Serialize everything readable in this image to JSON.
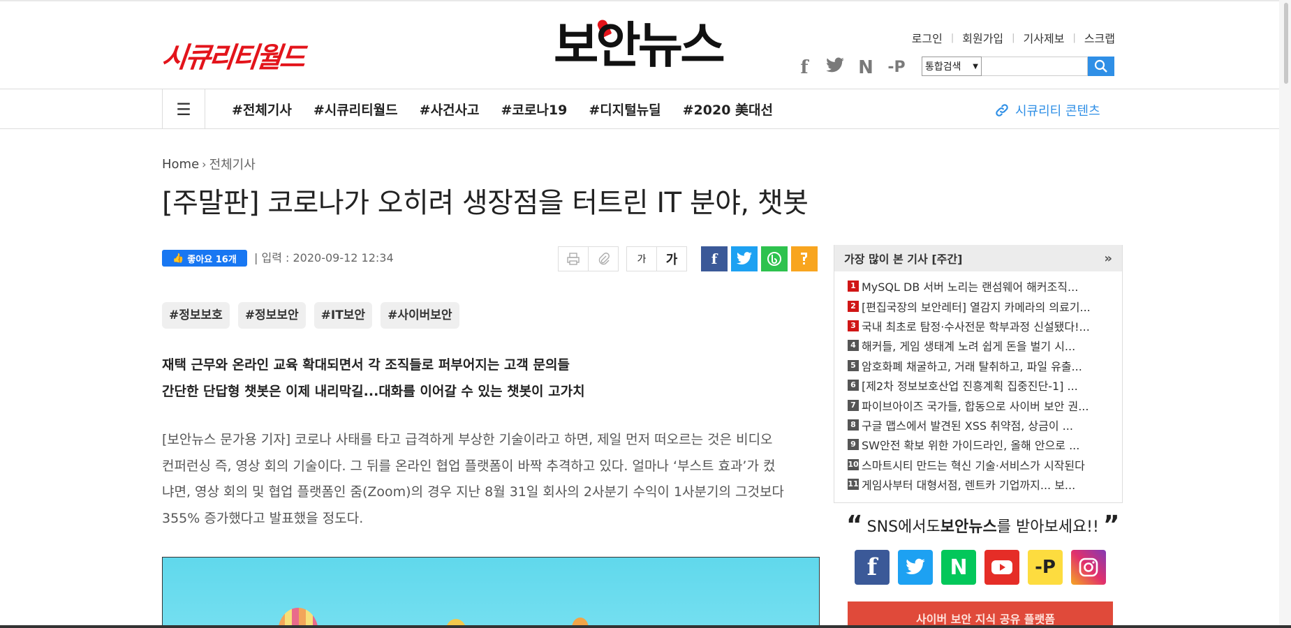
{
  "header": {
    "securityworld_logo": "시큐리티월드",
    "boannews_logo": "보안뉴스",
    "top_links": [
      "로그인",
      "회원가입",
      "기사제보",
      "스크랩"
    ],
    "sns": [
      {
        "icon": "facebook-icon",
        "glyph": "f"
      },
      {
        "icon": "twitter-icon",
        "glyph": "🐦"
      },
      {
        "icon": "naver-icon",
        "glyph": "N"
      },
      {
        "icon": "post-icon",
        "glyph": "-P"
      }
    ],
    "search": {
      "select_value": "통합검색",
      "placeholder": ""
    }
  },
  "nav": {
    "items": [
      "#전체기사",
      "#시큐리티월드",
      "#사건사고",
      "#코로나19",
      "#디지털뉴딜",
      "#2020 美대선"
    ],
    "right_link": "시큐리티 콘텐츠"
  },
  "article": {
    "breadcrumb": {
      "home": "Home",
      "current": "전체기사"
    },
    "title": "[주말판] 코로나가 오히려 생장점을 터트린 IT 분야, 챗봇",
    "like_label": "좋아요 16개",
    "input_date": "| 입력 : 2020-09-12 12:34",
    "font_small": "가",
    "font_large": "가",
    "tags": [
      "#정보보호",
      "#정보보안",
      "#IT보안",
      "#사이버보안"
    ],
    "subheads": [
      "재택 근무와 온라인 교육 확대되면서 각 조직들로 퍼부어지는 고객 문의들",
      "간단한 단답형 챗봇은 이제 내리막길...대화를 이어갈 수 있는 챗봇이 고가치"
    ],
    "body_lines": [
      "[보안뉴스 문가용 기자] 코로나 사태를 타고 급격하게 부상한 기술이라고 하면, 제일 먼저 떠오르는 것은 비디오",
      "컨퍼런싱 즉, 영상 회의 기술이다. 그 뒤를 온라인 협업 플랫폼이 바짝 추격하고 있다. 얼마나 ‘부스트 효과’가 컸",
      "냐면, 영상 회의 및 협업 플랫폼인 줌(Zoom)의 경우 지난 8월 31일 회사의 2사분기 수익이 1사분기의 그것보다",
      "355% 증가했다고 발표했을 정도다."
    ]
  },
  "sidebar": {
    "popular_title": "가장 많이 본 기사 [주간]",
    "popular_more": "»",
    "popular_items": [
      {
        "rank": "1",
        "text": "MySQL DB 서버 노리는 랜섬웨어 해커조직..."
      },
      {
        "rank": "2",
        "text": "[편집국장의 보안레터] 열감지 카메라의 의료기..."
      },
      {
        "rank": "3",
        "text": "국내 최초로 탐정·수사전문 학부과정 신설됐다!..."
      },
      {
        "rank": "4",
        "text": "해커들, 게임 생태계 노려 쉽게 돈을 벌기 시..."
      },
      {
        "rank": "5",
        "text": "암호화폐 채굴하고, 거래 탈취하고, 파일 유출..."
      },
      {
        "rank": "6",
        "text": "[제2차 정보보호산업 진흥계획 집중진단-1] ..."
      },
      {
        "rank": "7",
        "text": "파이브아이즈 국가들, 합동으로 사이버 보안 권..."
      },
      {
        "rank": "8",
        "text": "구글 맵스에서 발견된 XSS 취약점, 상금이 ..."
      },
      {
        "rank": "9",
        "text": "SW안전 확보 위한 가이드라인, 올해 안으로 ..."
      },
      {
        "rank": "10",
        "text": "스마트시티 만드는 혁신 기술·서비스가 시작된다"
      },
      {
        "rank": "11",
        "text": "게임사부터 대형서점, 렌트카 기업까지... 보..."
      }
    ],
    "sns_title_pre": "SNS에서도 ",
    "sns_title_bold": "보안뉴스",
    "sns_title_post": "를 받아보세요!!",
    "sns_icons": [
      {
        "name": "facebook",
        "glyph": "f",
        "color": "#3b5998"
      },
      {
        "name": "twitter",
        "glyph": "🐦",
        "color": "#1da1f2"
      },
      {
        "name": "naver",
        "glyph": "N",
        "color": "#03c75a"
      },
      {
        "name": "youtube",
        "glyph": "▶",
        "color": "#e52d27"
      },
      {
        "name": "post",
        "glyph": "-P",
        "color": "#fddc3f"
      },
      {
        "name": "instagram",
        "glyph": "◎",
        "color": "#c13584"
      }
    ],
    "promo_text": "사이버 보안 지식 공유 플랫폼"
  },
  "colors": {
    "accent": "#2f8fe6",
    "brand_red": "#e3141b",
    "rank_red": "#d01616",
    "facebook": "#3b5998",
    "twitter": "#1da1f2",
    "band": "#2ec24e",
    "kakao": "#f8a51f"
  }
}
